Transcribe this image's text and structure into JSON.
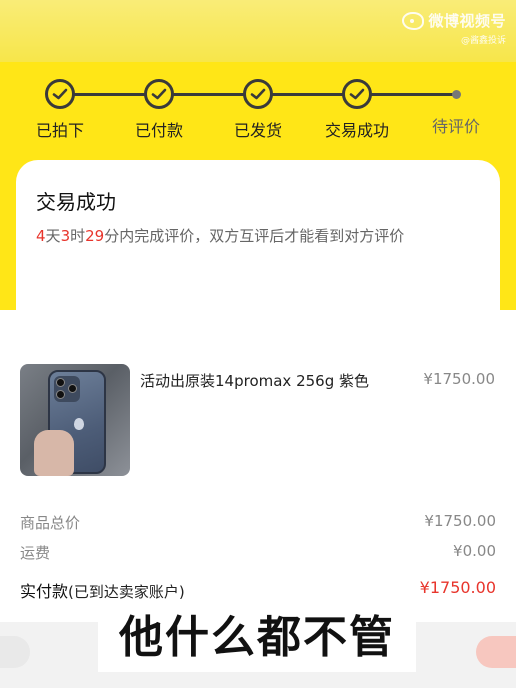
{
  "watermark": {
    "title": "微博视频号",
    "subtitle": "@酱鑫投诉"
  },
  "steps": [
    {
      "label": "已拍下",
      "done": true
    },
    {
      "label": "已付款",
      "done": true
    },
    {
      "label": "已发货",
      "done": true
    },
    {
      "label": "交易成功",
      "done": true
    },
    {
      "label": "待评价",
      "done": false
    }
  ],
  "status": {
    "title": "交易成功",
    "days": "4",
    "days_unit": "天",
    "hours": "3",
    "hours_unit": "时",
    "minutes": "29",
    "rest": "分内完成评价，双方互评后才能看到对方评价"
  },
  "product": {
    "name": "活动出原装14promax 256g 紫色",
    "price": "¥1750.00"
  },
  "summary": {
    "goods_total_label": "商品总价",
    "goods_total_value": "¥1750.00",
    "shipping_label": "运费",
    "shipping_value": "¥0.00",
    "paid_label": "实付款",
    "paid_note": "(已到达卖家账户)",
    "paid_value": "¥1750.00"
  },
  "caption": "他什么都不管",
  "colors": {
    "accent_yellow": "#ffe617",
    "price_red": "#e8352c"
  }
}
